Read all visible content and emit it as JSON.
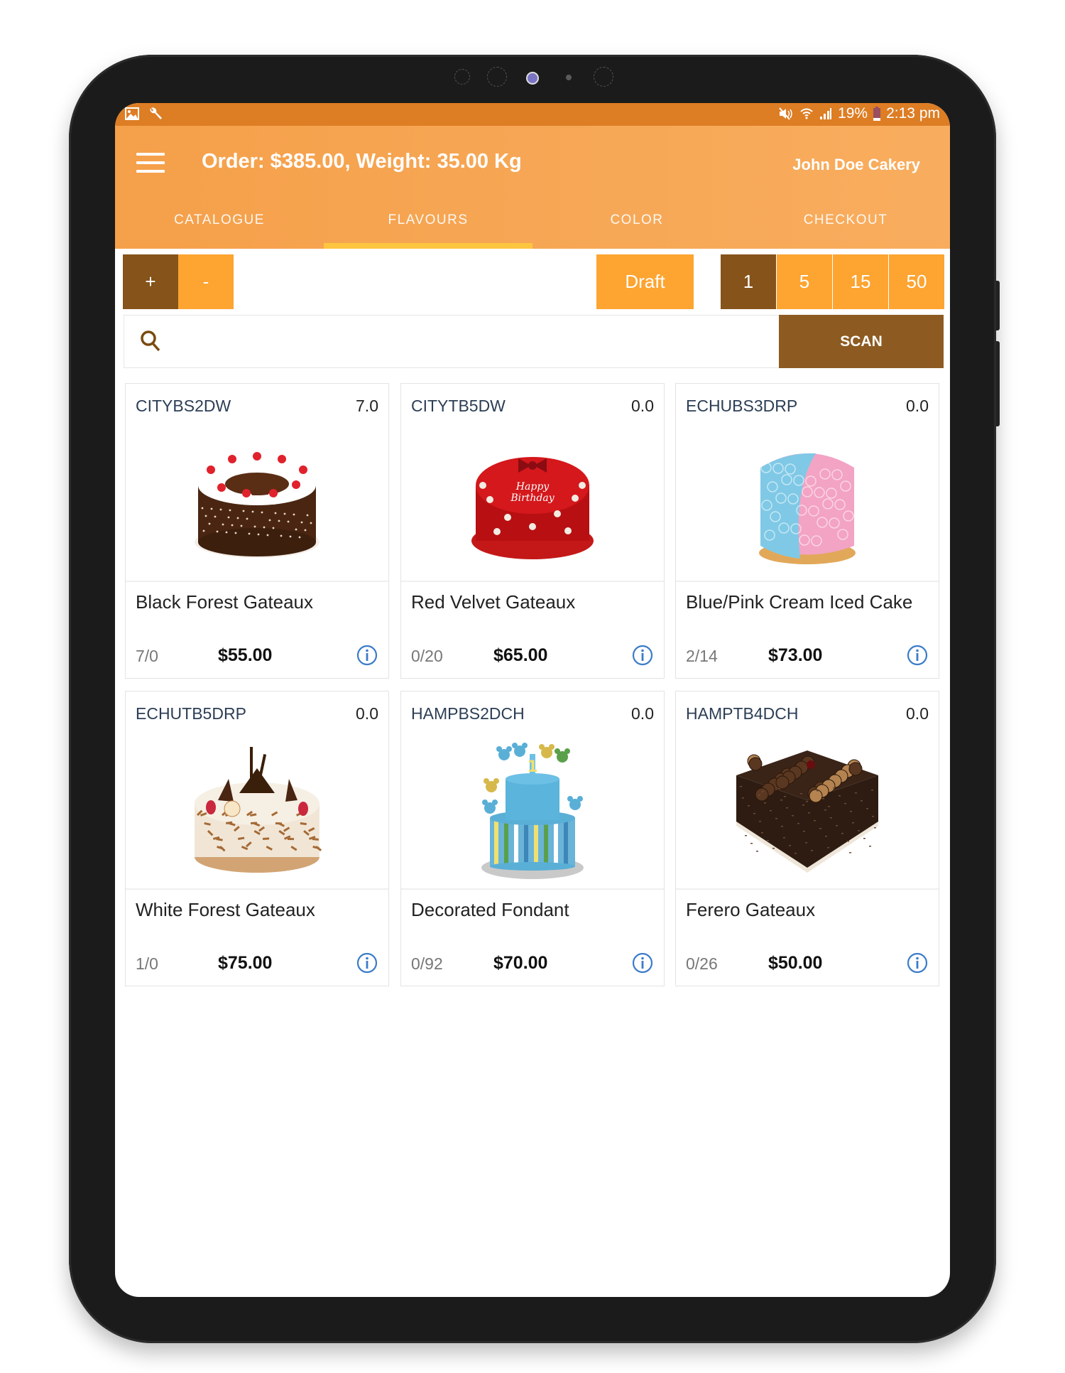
{
  "status_bar": {
    "left_icons": [
      "image-icon",
      "wrench-icon"
    ],
    "right_icons": [
      "mute-icon",
      "wifi-icon",
      "signal-icon"
    ],
    "battery": "19%",
    "time": "2:13 pm"
  },
  "app_bar": {
    "title": "Order: $385.00, Weight: 35.00 Kg",
    "shop_name": "John Doe Cakery",
    "menu_icon": "hamburger-icon"
  },
  "tabs": [
    {
      "label": "CATALOGUE",
      "active": false
    },
    {
      "label": "FLAVOURS",
      "active": true
    },
    {
      "label": "COLOR",
      "active": false
    },
    {
      "label": "CHECKOUT",
      "active": false
    }
  ],
  "toolbar": {
    "plus_label": "+",
    "minus_label": "-",
    "draft_label": "Draft",
    "quantities": [
      "1",
      "5",
      "15",
      "50"
    ],
    "selected_quantity": "1"
  },
  "search": {
    "placeholder": "",
    "value": "",
    "scan_label": "SCAN"
  },
  "colors": {
    "status_bar": "#dd7d24",
    "app_bar": "#f5a04a",
    "tab_indicator": "#fec93f",
    "brown_button": "#86531a",
    "orange_button": "#fda431",
    "scan_button": "#8d5b21",
    "info_icon": "#3b7cc9"
  },
  "products": [
    {
      "code": "CITYBS2DW",
      "qty": "7.0",
      "name": "Black Forest Gateaux",
      "stock": "7/0",
      "price": "$55.00",
      "image": "black-forest-cake"
    },
    {
      "code": "CITYTB5DW",
      "qty": "0.0",
      "name": "Red Velvet Gateaux",
      "stock": "0/20",
      "price": "$65.00",
      "image": "red-velvet-cake",
      "image_text": "Happy Birthday"
    },
    {
      "code": "ECHUBS3DRP",
      "qty": "0.0",
      "name": "Blue/Pink Cream Iced Cake",
      "stock": "2/14",
      "price": "$73.00",
      "image": "blue-pink-cake"
    },
    {
      "code": "ECHUTB5DRP",
      "qty": "0.0",
      "name": "White Forest Gateaux",
      "stock": "1/0",
      "price": "$75.00",
      "image": "white-forest-cake"
    },
    {
      "code": "HAMPBS2DCH",
      "qty": "0.0",
      "name": "Decorated Fondant",
      "stock": "0/92",
      "price": "$70.00",
      "image": "fondant-cake"
    },
    {
      "code": "HAMPTB4DCH",
      "qty": "0.0",
      "name": "Ferero Gateaux",
      "stock": "0/26",
      "price": "$50.00",
      "image": "ferrero-cake"
    }
  ]
}
